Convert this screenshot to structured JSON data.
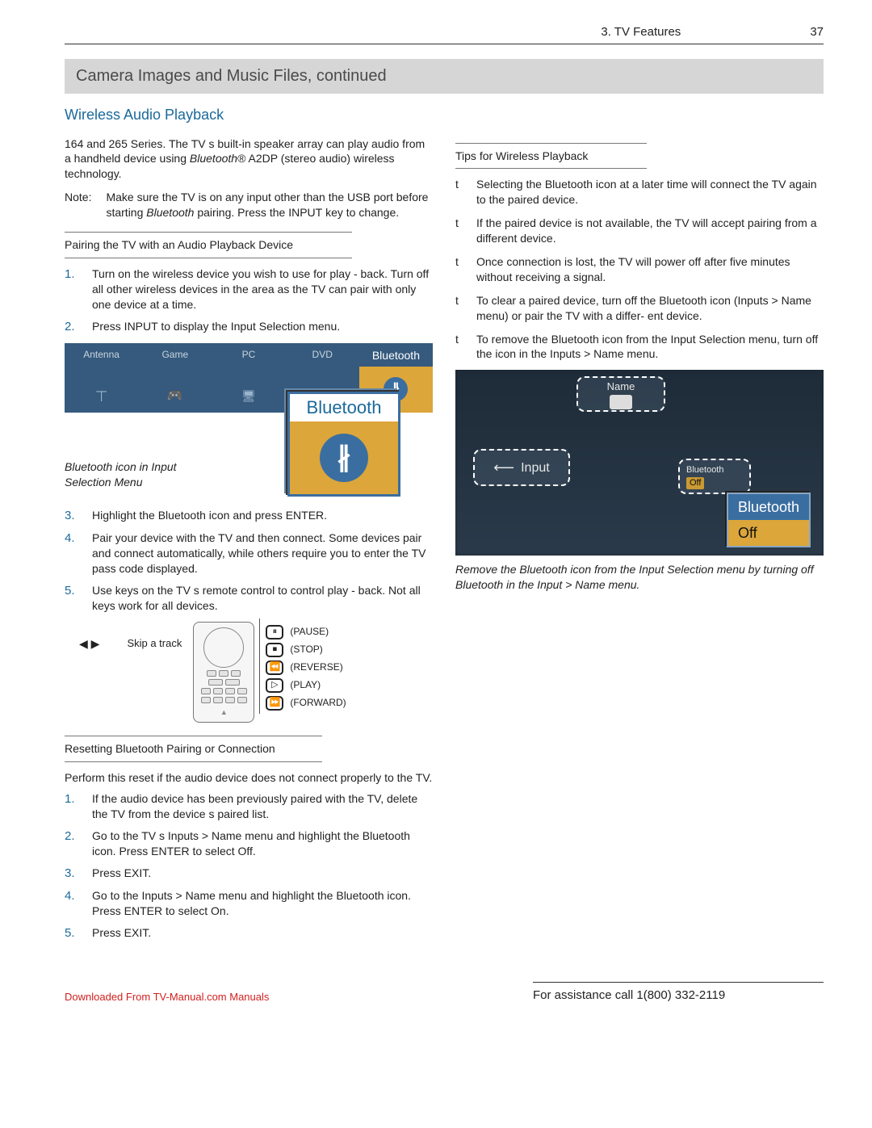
{
  "header": {
    "chapter": "3.  TV Features",
    "page": "37"
  },
  "title_bar": "Camera Images and Music Files, continued",
  "section_heading": "Wireless Audio Playback",
  "left": {
    "intro_pre": "164 and 265 Series.   The TV s built-in speaker array can play audio from a handheld device using ",
    "intro_em": "Bluetooth",
    "intro_post": "® A2DP (stereo audio) wireless technology.",
    "note_label": "Note:",
    "note_body_pre": "Make sure the TV is on any input other than the USB port before starting  ",
    "note_body_em": "Bluetooth",
    "note_body_mid": " pairing. Press the ",
    "note_key": "INPUT",
    "note_body_post": " key to change.",
    "sub1": "Pairing the TV with an Audio Playback Device",
    "steps1": [
      "Turn on the wireless device you wish to use for play - back.  Turn off all other wireless devices in the area as the TV can pair with only one device at a time.",
      "Press INPUT to display the Input Selection   menu."
    ],
    "fig1": {
      "cells": [
        "Antenna",
        "Game",
        "PC",
        "DVD",
        "Bluetooth"
      ],
      "popup_title": "Bluetooth",
      "caption": "Bluetooth icon in Input Selection Menu"
    },
    "steps2": [
      "Highlight the Bluetooth  icon and press ENTER.",
      "Pair your device with the TV and then connect.  Some devices pair and connect automatically, while others require you to enter the TV pass code displayed.",
      "Use keys on the TV s remote control to control play - back.  Not all keys work for all devices."
    ],
    "remote": {
      "skip_label": "Skip a track",
      "arrows": "◀ ▶",
      "legend": [
        {
          "sym": "⏸",
          "text": "(PAUSE)"
        },
        {
          "sym": "⏹",
          "text": "(STOP)"
        },
        {
          "sym": "⏪",
          "text": "(REVERSE)"
        },
        {
          "sym": "▷",
          "text": "(PLAY)"
        },
        {
          "sym": "⏩",
          "text": "(FORWARD)"
        }
      ]
    },
    "sub2": "Resetting Bluetooth Pairing or Connection",
    "reset_intro": "Perform this reset if the audio device does not connect properly to the TV.",
    "steps3": [
      "If the audio device has been previously paired with the TV, delete the TV from the device s paired list.",
      "Go to the TV s Inputs > Name   menu and highlight the Bluetooth icon.  Press ENTER to select Off.",
      "Press EXIT.",
      "Go to the Inputs > Name   menu and highlight the Bluetooth icon.  Press ENTER to select On.",
      "Press EXIT."
    ]
  },
  "right": {
    "sub": "Tips for Wireless Playback",
    "tips": [
      "Selecting the Bluetooth  icon at a later time will connect the TV again to the paired device.",
      "If the paired device is not available, the TV will accept pairing from a different device.",
      "Once connection is lost, the TV will power off after five minutes without receiving a signal.",
      "To clear a paired device, turn off the Bluetooth  icon (Inputs > Name   menu) or pair the TV with a differ- ent device.",
      "To remove the Bluetooth  icon from the Input Selection  menu, turn off the icon in the Inputs > Name  menu."
    ],
    "fig2": {
      "name_label": "Name",
      "input_label": "Input",
      "bt_small_label": "Bluetooth",
      "bt_small_state": "Off",
      "popup_title": "Bluetooth",
      "popup_state": "Off",
      "caption": "Remove the Bluetooth icon from the Input Selection menu by turning off Bluetooth in the Input > Name menu."
    }
  },
  "footer": {
    "download": "Downloaded From TV-Manual.com Manuals",
    "assist": "For assistance call 1(800) 332-2119"
  }
}
